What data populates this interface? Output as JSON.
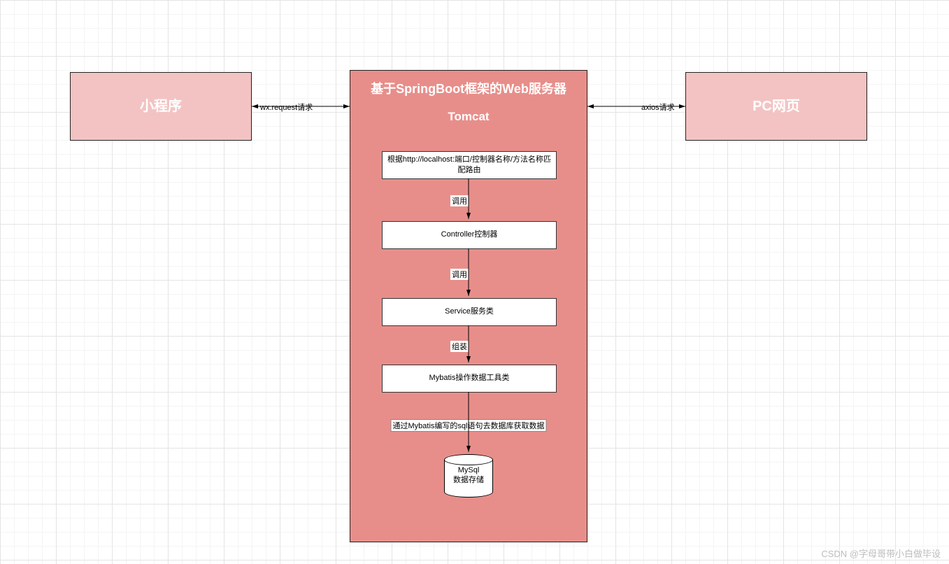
{
  "left_block": {
    "label": "小程序"
  },
  "right_block": {
    "label": "PC网页"
  },
  "left_arrow_label": "wx.request请求",
  "right_arrow_label": "axios请求",
  "server": {
    "title": "基于SpringBoot框架的Web服务器",
    "subtitle": "Tomcat",
    "steps": [
      "根据http://localhost:端口/控制器名称/方法名称匹配路由",
      "Controller控制器",
      "Service服务类",
      "Mybatis操作数据工具类"
    ],
    "arrows": [
      "调用",
      "调用",
      "组装",
      "通过Mybatis编写的sql语句去数据库获取数据"
    ],
    "db": {
      "name": "MySql",
      "desc": "数据存储"
    }
  },
  "watermark": "CSDN @字母哥带小白做毕设"
}
